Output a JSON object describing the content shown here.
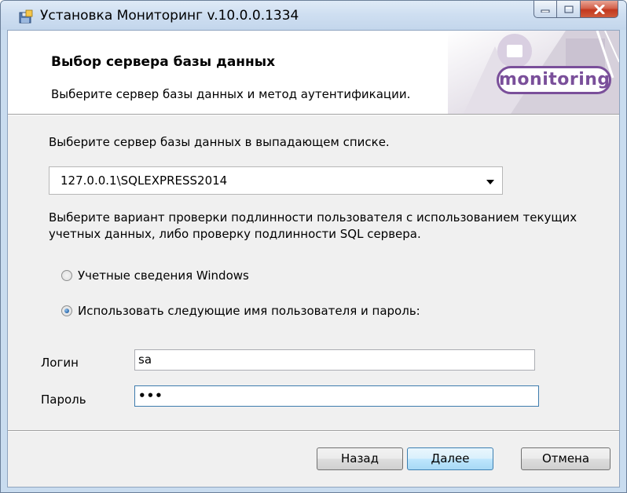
{
  "window": {
    "title": "Установка Мониторинг v.10.0.0.1334"
  },
  "banner": {
    "title": "Выбор сервера базы данных",
    "description": "Выберите сервер базы данных и метод аутентификации.",
    "logo_text": "monitoring",
    "accent_color": "#7a4f9a"
  },
  "server": {
    "prompt": "Выберите сервер базы данных в выпадающем списке.",
    "selected_value": "127.0.0.1\\SQLEXPRESS2014"
  },
  "auth": {
    "prompt_line1": "Выберите вариант проверки подлинности пользователя с использованием текущих",
    "prompt_line2": "учетных данных, либо проверку подлинности SQL сервера.",
    "option_windows": "Учетные сведения Windows",
    "option_sql": "Использовать следующие имя пользователя и пароль:",
    "selected": "sql"
  },
  "credentials": {
    "login_label": "Логин",
    "login_value": "sa",
    "password_label": "Пароль",
    "password_value": "•••"
  },
  "buttons": {
    "back": "Назад",
    "next": "Далее",
    "cancel": "Отмена"
  }
}
